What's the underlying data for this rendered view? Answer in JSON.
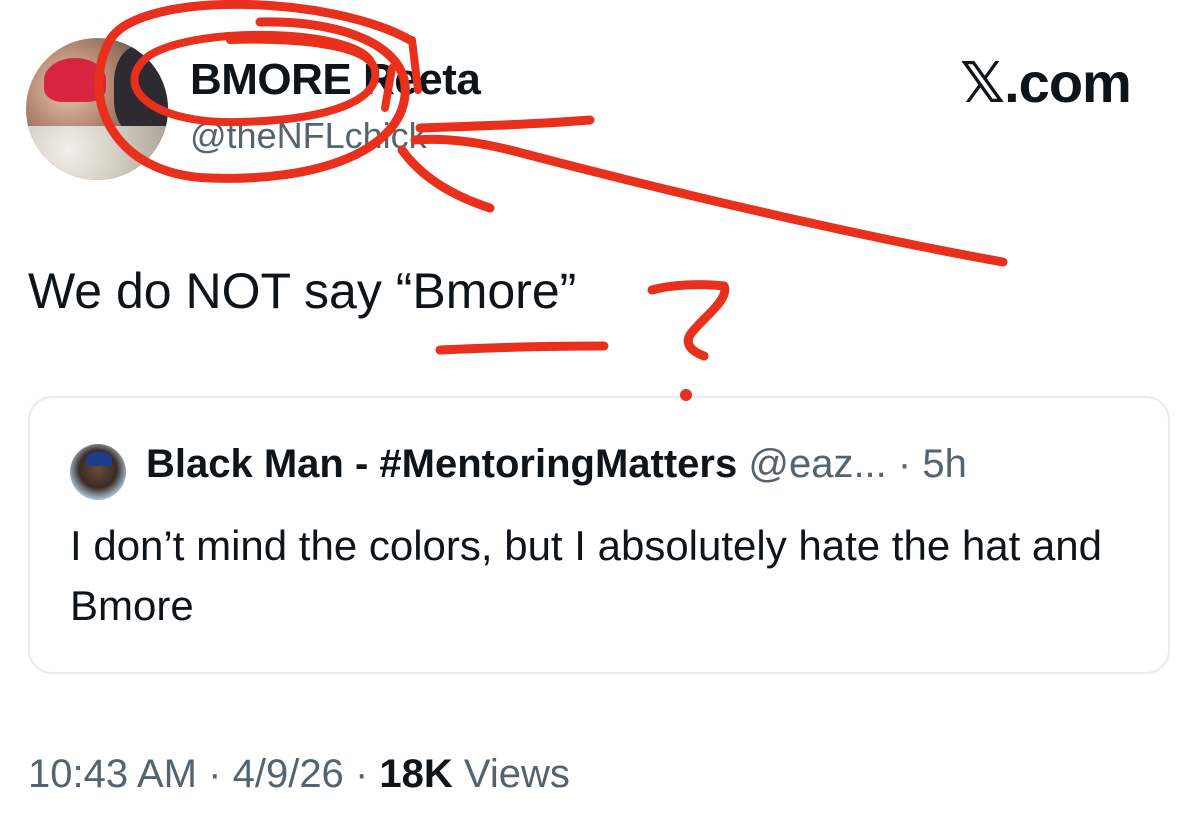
{
  "tweet": {
    "display_name": "BMORE Reeta",
    "handle": "@theNFLchick",
    "brand": "𝕏.com",
    "text": "We do NOT say “Bmore”"
  },
  "quote": {
    "name": "Black Man - #MentoringMatters",
    "handle": "@eaz...",
    "dot": "·",
    "time": "5h",
    "text": "I don’t mind the colors, but I absolutely hate the hat and Bmore"
  },
  "meta": {
    "time": "10:43 AM",
    "sep1": "·",
    "date": "4/9/26",
    "sep2": "·",
    "views_count": "18K",
    "views_label": "Views"
  },
  "annotations": {
    "color": "#e8301c",
    "question_mark": "?"
  }
}
